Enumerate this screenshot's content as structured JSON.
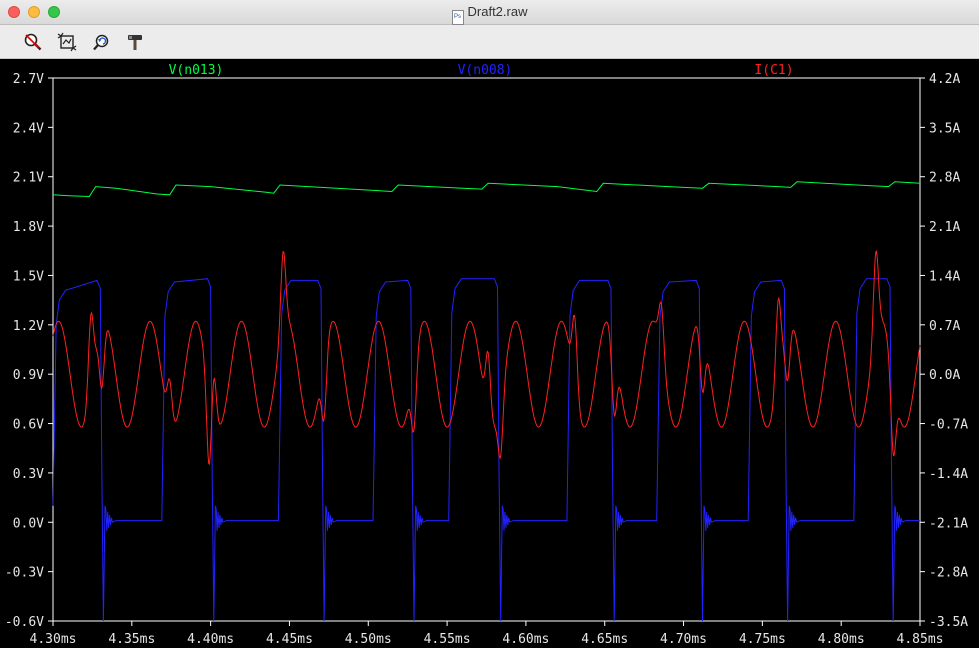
{
  "window": {
    "title": "Draft2.raw",
    "doc_icon": "Ps"
  },
  "toolbar": {
    "buttons": [
      {
        "icon": "zoom-cancel-icon"
      },
      {
        "icon": "autorange-icon"
      },
      {
        "icon": "undo-zoom-icon"
      },
      {
        "icon": "hammer-icon"
      }
    ]
  },
  "colors": {
    "background": "#000000",
    "axis": "#ffffff",
    "grid": "#3a3a3a",
    "n013": "#00ff40",
    "n008": "#2222ff",
    "c1": "#ff2020"
  },
  "chart_data": {
    "type": "line",
    "x_unit": "ms",
    "x_range": [
      4.3,
      4.85
    ],
    "x_ticks": [
      "4.30ms",
      "4.35ms",
      "4.40ms",
      "4.45ms",
      "4.50ms",
      "4.55ms",
      "4.60ms",
      "4.65ms",
      "4.70ms",
      "4.75ms",
      "4.80ms",
      "4.85ms"
    ],
    "y_left": {
      "range": [
        -0.6,
        2.7
      ],
      "ticks": [
        "2.7V",
        "2.4V",
        "2.1V",
        "1.8V",
        "1.5V",
        "1.2V",
        "0.9V",
        "0.6V",
        "0.3V",
        "0.0V",
        "-0.3V",
        "-0.6V"
      ]
    },
    "y_right": {
      "range": [
        -3.5,
        4.2
      ],
      "ticks": [
        "4.2A",
        "3.5A",
        "2.8A",
        "2.1A",
        "1.4A",
        "0.7A",
        "0.0A",
        "-0.7A",
        "-1.4A",
        "-2.1A",
        "-2.8A",
        "-3.5A"
      ]
    },
    "series": [
      {
        "name": "V(n013)",
        "axis": "left",
        "color": "#00ff40",
        "points": [
          [
            4.3,
            1.99
          ],
          [
            4.31,
            1.985
          ],
          [
            4.323,
            1.98
          ],
          [
            4.327,
            2.04
          ],
          [
            4.34,
            2.03
          ],
          [
            4.366,
            1.995
          ],
          [
            4.374,
            1.99
          ],
          [
            4.378,
            2.05
          ],
          [
            4.4,
            2.04
          ],
          [
            4.436,
            2.005
          ],
          [
            4.44,
            2.0
          ],
          [
            4.444,
            2.05
          ],
          [
            4.48,
            2.03
          ],
          [
            4.515,
            2.01
          ],
          [
            4.519,
            2.05
          ],
          [
            4.56,
            2.03
          ],
          [
            4.572,
            2.025
          ],
          [
            4.576,
            2.06
          ],
          [
            4.62,
            2.04
          ],
          [
            4.645,
            2.01
          ],
          [
            4.649,
            2.06
          ],
          [
            4.7,
            2.035
          ],
          [
            4.712,
            2.03
          ],
          [
            4.716,
            2.06
          ],
          [
            4.76,
            2.04
          ],
          [
            4.768,
            2.035
          ],
          [
            4.772,
            2.07
          ],
          [
            4.81,
            2.05
          ],
          [
            4.83,
            2.04
          ],
          [
            4.834,
            2.07
          ],
          [
            4.85,
            2.06
          ]
        ]
      },
      {
        "name": "V(n008)",
        "axis": "left",
        "color": "#2222ff",
        "pulses": [
          {
            "rise": 4.3,
            "fall": 4.332,
            "top_start": 1.35,
            "top_end": 1.47
          },
          {
            "rise": 4.369,
            "fall": 4.402,
            "top_start": 1.4,
            "top_end": 1.48
          },
          {
            "rise": 4.443,
            "fall": 4.472,
            "top_start": 1.41,
            "top_end": 1.47
          },
          {
            "rise": 4.503,
            "fall": 4.529,
            "top_start": 1.4,
            "top_end": 1.47
          },
          {
            "rise": 4.551,
            "fall": 4.584,
            "top_start": 1.42,
            "top_end": 1.48
          },
          {
            "rise": 4.626,
            "fall": 4.656,
            "top_start": 1.41,
            "top_end": 1.47
          },
          {
            "rise": 4.683,
            "fall": 4.712,
            "top_start": 1.4,
            "top_end": 1.47
          },
          {
            "rise": 4.741,
            "fall": 4.766,
            "top_start": 1.4,
            "top_end": 1.47
          },
          {
            "rise": 4.808,
            "fall": 4.833,
            "top_start": 1.42,
            "top_end": 1.48
          }
        ],
        "low_level": 0.01,
        "dip_level": -0.6
      },
      {
        "name": "I(C1)",
        "axis": "right",
        "color": "#ff2020",
        "center": 0.0,
        "amplitude": 0.75,
        "period_ms": 0.029,
        "spikes": [
          [
            4.324,
            1.35
          ],
          [
            4.331,
            -1.2
          ],
          [
            4.374,
            0.9
          ],
          [
            4.399,
            -1.5
          ],
          [
            4.402,
            1.0
          ],
          [
            4.446,
            1.4
          ],
          [
            4.472,
            -1.2
          ],
          [
            4.529,
            -1.2
          ],
          [
            4.576,
            1.2
          ],
          [
            4.584,
            -1.1
          ],
          [
            4.631,
            1.3
          ],
          [
            4.656,
            -1.3
          ],
          [
            4.686,
            1.0
          ],
          [
            4.712,
            -1.2
          ],
          [
            4.76,
            1.4
          ],
          [
            4.766,
            -1.1
          ],
          [
            4.822,
            1.5
          ],
          [
            4.833,
            -1.4
          ]
        ]
      }
    ]
  }
}
